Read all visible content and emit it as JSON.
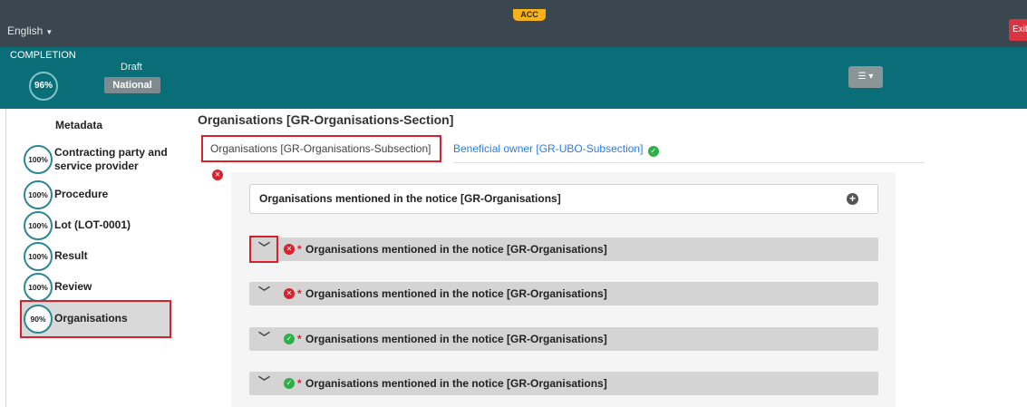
{
  "topbar": {
    "language": "English",
    "env": "ACC",
    "exit": "Exit"
  },
  "header": {
    "completion_label": "COMPLETION",
    "completion_pct": "96%",
    "status": "Draft",
    "scope": "National"
  },
  "sidebar": {
    "title": "Metadata",
    "items": [
      {
        "pct": "100%",
        "label": "Contracting party and service provider"
      },
      {
        "pct": "100%",
        "label": "Procedure"
      },
      {
        "pct": "100%",
        "label": "Lot (LOT-0001)"
      },
      {
        "pct": "100%",
        "label": "Result"
      },
      {
        "pct": "100%",
        "label": "Review"
      },
      {
        "pct": "90%",
        "label": "Organisations"
      }
    ]
  },
  "main": {
    "section_title": "Organisations [GR-Organisations-Section]",
    "tabs": [
      {
        "label": "Organisations  [GR-Organisations-Subsection]",
        "status": "error"
      },
      {
        "label": "Beneficial owner  [GR-UBO-Subsection]",
        "status": "ok"
      }
    ],
    "add_row_label": "Organisations mentioned in the notice  [GR-Organisations]",
    "groups": [
      {
        "label": "Organisations mentioned in the notice  [GR-Organisations]",
        "status": "error",
        "required": "*"
      },
      {
        "label": "Organisations mentioned in the notice  [GR-Organisations]",
        "status": "error",
        "required": "*"
      },
      {
        "label": "Organisations mentioned in the notice  [GR-Organisations]",
        "status": "ok",
        "required": "*"
      },
      {
        "label": "Organisations mentioned in the notice  [GR-Organisations]",
        "status": "ok",
        "required": "*"
      }
    ]
  },
  "colors": {
    "topbar": "#3a474e",
    "header": "#0a6e79",
    "error": "#d9202d",
    "ok": "#2db04a",
    "link": "#2c7be5"
  }
}
